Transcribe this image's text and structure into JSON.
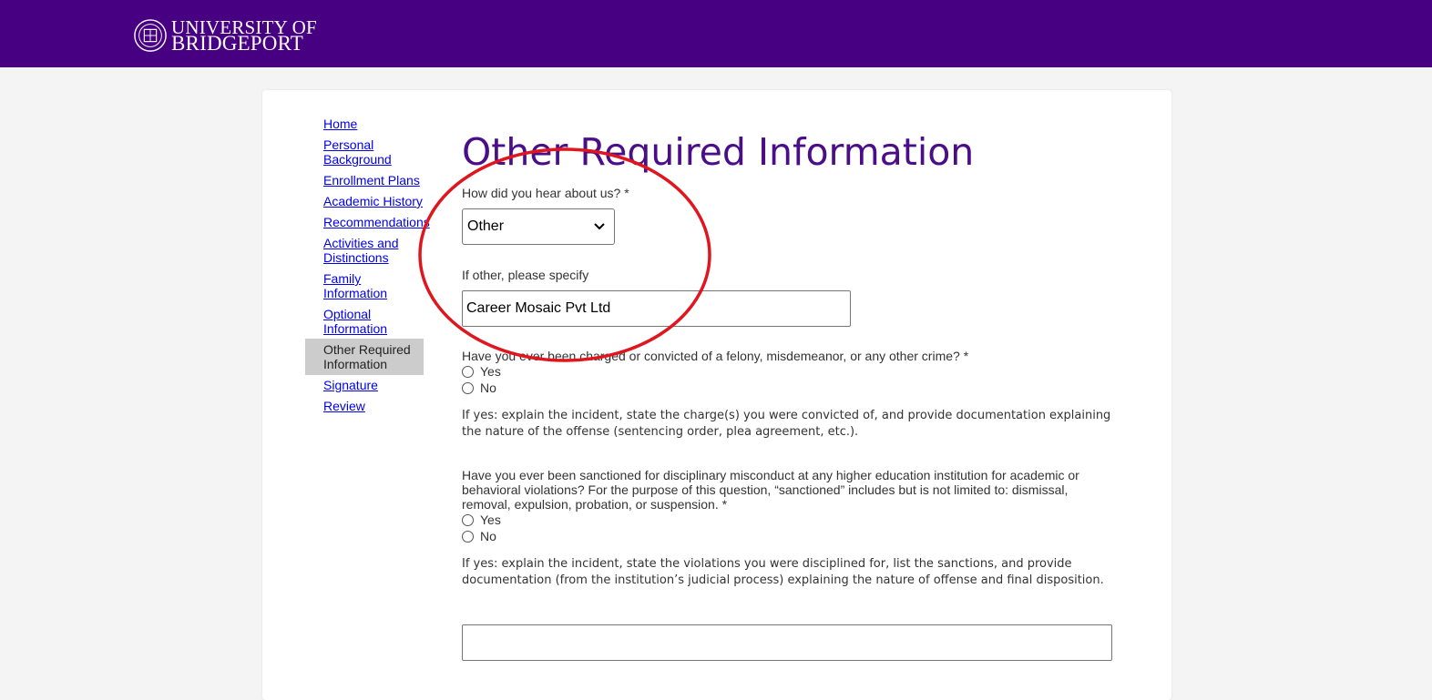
{
  "header": {
    "logo_line1": "UNIVERSITY OF",
    "logo_line2": "BRIDGEPORT",
    "brand_color": "#470082"
  },
  "nav": {
    "items": [
      {
        "label": "Home"
      },
      {
        "label": "Personal Background"
      },
      {
        "label": "Enrollment Plans"
      },
      {
        "label": "Academic History"
      },
      {
        "label": "Recommendations"
      },
      {
        "label": "Activities and Distinctions"
      },
      {
        "label": "Family Information"
      },
      {
        "label": "Optional Information"
      },
      {
        "label": "Other Required Information"
      },
      {
        "label": "Signature"
      },
      {
        "label": "Review"
      }
    ]
  },
  "main": {
    "title": "Other Required Information",
    "hear_label": "How did you hear about us? *",
    "hear_value": "Other",
    "other_label": "If other, please specify",
    "other_value": "Career Mosaic Pvt Ltd",
    "crime_question": "Have you ever been charged or convicted of a felony, misdemeanor, or any other crime? *",
    "crime_yes": "Yes",
    "crime_no": "No",
    "crime_note": "If yes: explain the incident, state the charge(s) you were convicted of, and provide documentation explaining the nature of the offense (sentencing order, plea agreement, etc.).",
    "discipline_question": "Have you ever been sanctioned for disciplinary misconduct at any higher education institution for academic or behavioral violations? For the purpose of this question, “sanctioned” includes but is not limited to: dismissal, removal, expulsion, probation, or suspension. *",
    "discipline_yes": "Yes",
    "discipline_no": "No",
    "discipline_note": "If yes: explain the incident, state the violations you were disciplined for, list the sanctions, and provide documentation (from the institution’s judicial process) explaining the nature of offense and final disposition.",
    "explanation_value": ""
  },
  "annotation_color": "#e0161e"
}
